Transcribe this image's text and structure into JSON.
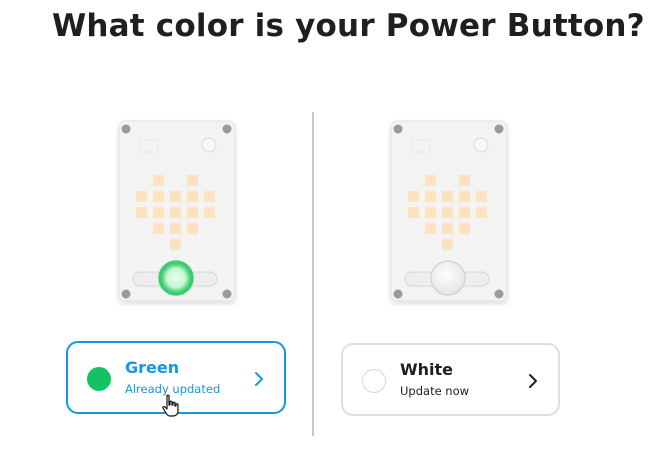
{
  "page": {
    "title": "What color is your Power Button?"
  },
  "options": [
    {
      "label": "Green",
      "status": "Already updated",
      "swatch_color": "#12c264",
      "accent_color": "#1597e5",
      "selected": true,
      "icon": "chevron-right-icon"
    },
    {
      "label": "White",
      "status": "Update now",
      "swatch_color": "#ffffff",
      "accent_color": "#1f1f1f",
      "selected": false,
      "icon": "chevron-right-icon"
    }
  ],
  "cursor": {
    "icon": "hand-pointer-icon"
  }
}
